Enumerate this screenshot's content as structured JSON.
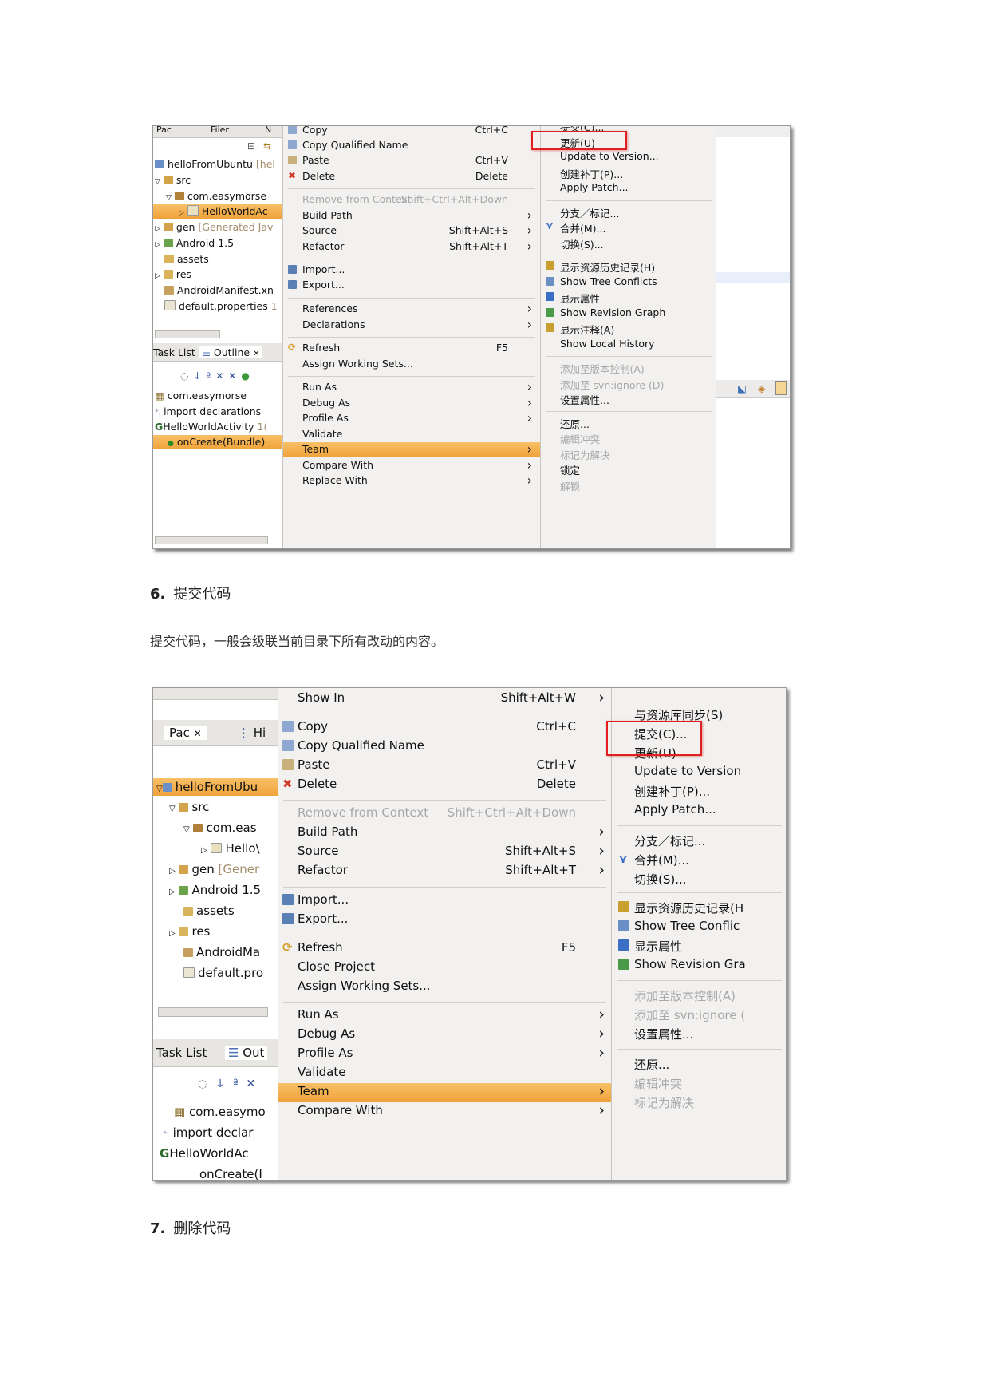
{
  "shot1": {
    "tabs": [
      "Pac",
      "Filer",
      "N"
    ],
    "tree": {
      "project": "helloFromUbuntu",
      "project_suffix": "[hel",
      "src": "src",
      "package": "com.easymorse",
      "activity": "HelloWorldAc",
      "gen": "gen",
      "gen_suffix": "[Generated Jav",
      "android": "Android 1.5",
      "assets": "assets",
      "res": "res",
      "manifest": "AndroidManifest.xn",
      "default_props": "default.properties",
      "default_props_suffix": "1"
    },
    "outline_tabs": [
      "Task List",
      "Outline"
    ],
    "outline": [
      "com.easymorse",
      "import declarations",
      "HelloWorldActivity",
      "onCreate(Bundle)"
    ],
    "outline_activity_suffix": "1(",
    "menu": [
      {
        "label": "Copy",
        "accel": "Ctrl+C",
        "icon": "copy-icon"
      },
      {
        "label": "Copy Qualified Name",
        "accel": "",
        "icon": "copy-qualified-icon"
      },
      {
        "label": "Paste",
        "accel": "Ctrl+V",
        "icon": "paste-icon"
      },
      {
        "label": "Delete",
        "accel": "Delete",
        "icon": "delete-icon"
      },
      {
        "label": "Remove from Context",
        "accel": "Shift+Ctrl+Alt+Down",
        "disabled": true
      },
      {
        "label": "Build Path",
        "accel": "",
        "submenu": true
      },
      {
        "label": "Source",
        "accel": "Shift+Alt+S",
        "submenu": true
      },
      {
        "label": "Refactor",
        "accel": "Shift+Alt+T",
        "submenu": true
      },
      {
        "label": "Import...",
        "accel": "",
        "icon": "import-icon"
      },
      {
        "label": "Export...",
        "accel": "",
        "icon": "export-icon"
      },
      {
        "label": "References",
        "accel": "",
        "submenu": true
      },
      {
        "label": "Declarations",
        "accel": "",
        "submenu": true
      },
      {
        "label": "Refresh",
        "accel": "F5",
        "icon": "refresh-icon"
      },
      {
        "label": "Assign Working Sets...",
        "accel": ""
      },
      {
        "label": "Run As",
        "accel": "",
        "submenu": true
      },
      {
        "label": "Debug As",
        "accel": "",
        "submenu": true
      },
      {
        "label": "Profile As",
        "accel": "",
        "submenu": true
      },
      {
        "label": "Validate",
        "accel": ""
      },
      {
        "label": "Team",
        "accel": "",
        "submenu": true,
        "highlight": true
      },
      {
        "label": "Compare With",
        "accel": "",
        "submenu": true
      },
      {
        "label": "Replace With",
        "accel": "",
        "submenu": true
      }
    ],
    "submenu": [
      {
        "label": "提交(C)..."
      },
      {
        "label": "更新(U)",
        "boxed": true
      },
      {
        "label": "Update to Version..."
      },
      {
        "label": "创建补丁(P)..."
      },
      {
        "label": "Apply Patch..."
      },
      {
        "label": "分支／标记..."
      },
      {
        "label": "合并(M)...",
        "icon": "merge-icon"
      },
      {
        "label": "切换(S)..."
      },
      {
        "label": "显示资源历史记录(H)",
        "icon": "history-icon"
      },
      {
        "label": "Show Tree Conflicts",
        "icon": "tree-conflicts-icon"
      },
      {
        "label": "显示属性",
        "icon": "properties-icon"
      },
      {
        "label": "Show Revision Graph",
        "icon": "revision-graph-icon"
      },
      {
        "label": "显示注释(A)",
        "icon": "annotate-icon"
      },
      {
        "label": "Show Local History"
      },
      {
        "label": "添加至版本控制(A)",
        "disabled": true
      },
      {
        "label": "添加至 svn:ignore (D)",
        "disabled": true
      },
      {
        "label": "设置属性..."
      },
      {
        "label": "还原..."
      },
      {
        "label": "编辑冲突",
        "disabled": true
      },
      {
        "label": "标记为解决",
        "disabled": true
      },
      {
        "label": "锁定"
      },
      {
        "label": "解锁",
        "disabled": true
      }
    ]
  },
  "section6": {
    "number": "6.",
    "title": "提交代码",
    "text": "提交代码，一般会级联当前目录下所有改动的内容。"
  },
  "shot2": {
    "tabs": [
      "Pac",
      "Hi"
    ],
    "tree": {
      "project": "helloFromUbu",
      "src": "src",
      "package": "com.eas",
      "activity": "Hello\\",
      "gen": "gen",
      "gen_suffix": "[Gener",
      "android": "Android 1.5",
      "assets": "assets",
      "res": "res",
      "manifest": "AndroidMa",
      "default_props": "default.pro"
    },
    "outline_tabs": [
      "Task List",
      "Out"
    ],
    "outline": [
      "com.easymo",
      "import declar",
      "HelloWorldAc",
      "onCreate(I"
    ],
    "menu": [
      {
        "label": "Show In",
        "accel": "Shift+Alt+W",
        "submenu": true
      },
      {
        "label": "Copy",
        "accel": "Ctrl+C",
        "icon": "copy-icon"
      },
      {
        "label": "Copy Qualified Name",
        "accel": "",
        "icon": "copy-qualified-icon"
      },
      {
        "label": "Paste",
        "accel": "Ctrl+V",
        "icon": "paste-icon"
      },
      {
        "label": "Delete",
        "accel": "Delete",
        "icon": "delete-icon"
      },
      {
        "label": "Remove from Context",
        "accel": "Shift+Ctrl+Alt+Down",
        "disabled": true
      },
      {
        "label": "Build Path",
        "accel": "",
        "submenu": true
      },
      {
        "label": "Source",
        "accel": "Shift+Alt+S",
        "submenu": true
      },
      {
        "label": "Refactor",
        "accel": "Shift+Alt+T",
        "submenu": true
      },
      {
        "label": "Import...",
        "accel": "",
        "icon": "import-icon"
      },
      {
        "label": "Export...",
        "accel": "",
        "icon": "export-icon"
      },
      {
        "label": "Refresh",
        "accel": "F5",
        "icon": "refresh-icon"
      },
      {
        "label": "Close Project",
        "accel": ""
      },
      {
        "label": "Assign Working Sets...",
        "accel": ""
      },
      {
        "label": "Run As",
        "accel": "",
        "submenu": true
      },
      {
        "label": "Debug As",
        "accel": "",
        "submenu": true
      },
      {
        "label": "Profile As",
        "accel": "",
        "submenu": true
      },
      {
        "label": "Validate",
        "accel": ""
      },
      {
        "label": "Team",
        "accel": "",
        "submenu": true,
        "highlight": true
      },
      {
        "label": "Compare With",
        "accel": "",
        "submenu": true
      }
    ],
    "submenu": [
      {
        "label": "与资源库同步(S)"
      },
      {
        "label": "提交(C)...",
        "boxed": true
      },
      {
        "label": "更新(U)"
      },
      {
        "label": "Update to Version"
      },
      {
        "label": "创建补丁(P)..."
      },
      {
        "label": "Apply Patch..."
      },
      {
        "label": "分支／标记..."
      },
      {
        "label": "合并(M)...",
        "icon": "merge-icon"
      },
      {
        "label": "切换(S)..."
      },
      {
        "label": "显示资源历史记录(H",
        "icon": "history-icon"
      },
      {
        "label": "Show Tree Conflic",
        "icon": "tree-conflicts-icon"
      },
      {
        "label": "显示属性",
        "icon": "properties-icon"
      },
      {
        "label": "Show Revision Gra",
        "icon": "revision-graph-icon"
      },
      {
        "label": "添加至版本控制(A)",
        "disabled": true
      },
      {
        "label": "添加至 svn:ignore (",
        "disabled": true
      },
      {
        "label": "设置属性..."
      },
      {
        "label": "还原..."
      },
      {
        "label": "编辑冲突",
        "disabled": true
      },
      {
        "label": "标记为解决",
        "disabled": true
      }
    ]
  },
  "section7": {
    "number": "7.",
    "title": "删除代码"
  }
}
